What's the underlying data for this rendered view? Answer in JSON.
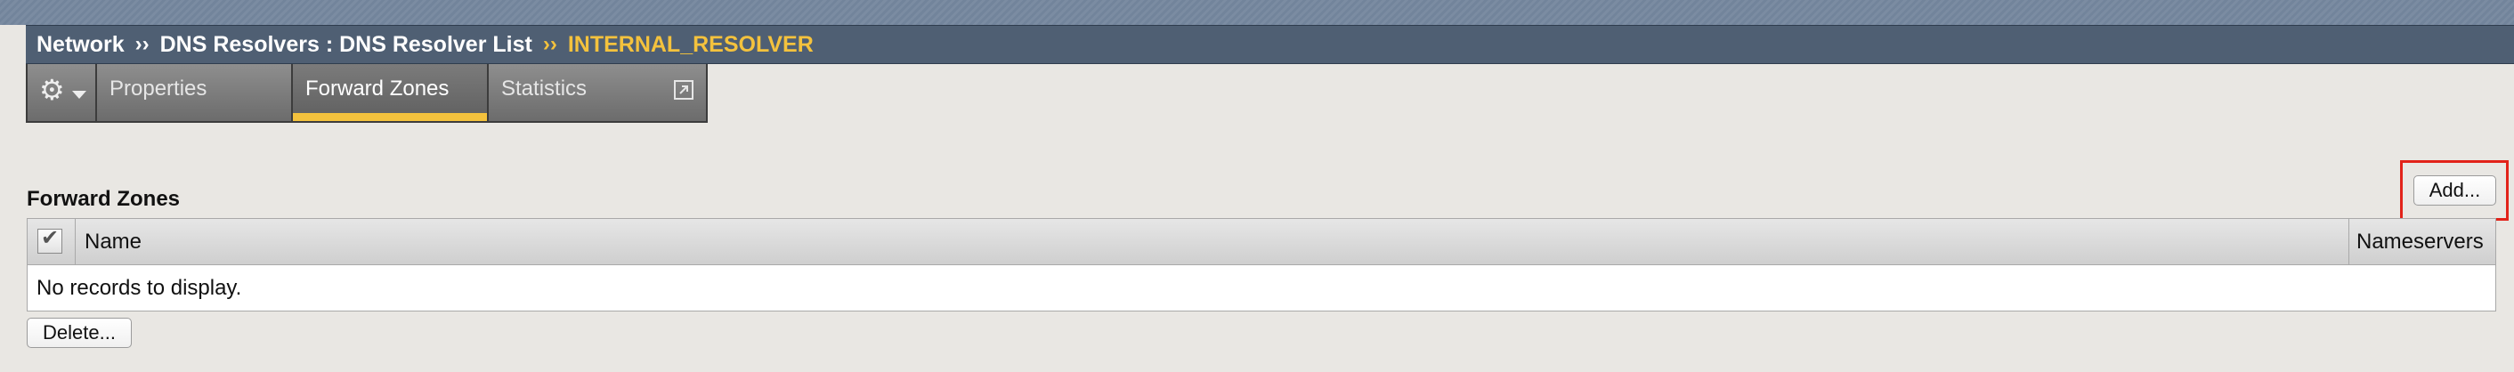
{
  "breadcrumb": {
    "items": [
      "Network",
      "DNS Resolvers : DNS Resolver List",
      "INTERNAL_RESOLVER"
    ],
    "separator": "››"
  },
  "tabs": [
    {
      "label": "Properties",
      "active": false
    },
    {
      "label": "Forward Zones",
      "active": true
    },
    {
      "label": "Statistics",
      "active": false
    }
  ],
  "section": {
    "title": "Forward Zones"
  },
  "buttons": {
    "add": "Add...",
    "delete": "Delete..."
  },
  "table": {
    "columns": [
      "Name",
      "Nameservers"
    ],
    "empty_message": "No records to display."
  },
  "icons": {
    "settings": "gear-icon",
    "menu": "chevron-down-icon",
    "external": "external-link-icon",
    "check": "checkbox-icon"
  },
  "colors": {
    "accent": "#f4c23d",
    "header_bg": "#4f5f73",
    "highlight": "#e2231a"
  }
}
